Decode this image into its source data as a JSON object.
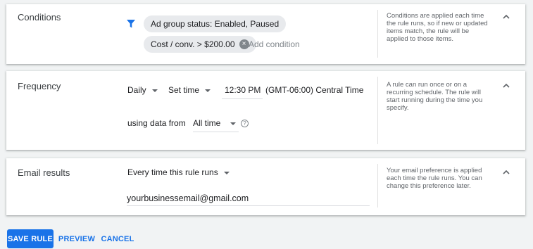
{
  "colors": {
    "accent": "#1a73e8",
    "background": "#f1f3f4",
    "chip": "#e8eaed"
  },
  "conditions": {
    "title": "Conditions",
    "filter_icon": "filter-icon",
    "chips": [
      {
        "label": "Ad group status: Enabled, Paused"
      },
      {
        "label": "Cost / conv. > $200.00"
      }
    ],
    "add_condition": "Add condition",
    "help": "Conditions are applied each time the rule runs, so if new or updated items match, the rule will be applied to those items.",
    "collapse_icon": "chevron-up-icon"
  },
  "frequency": {
    "title": "Frequency",
    "period": "Daily",
    "time_mode": "Set time",
    "time": "12:30 PM",
    "timezone": "(GMT-06:00) Central Time",
    "using_label": "using data from",
    "data_range": "All time",
    "help_icon": "question-circle-icon",
    "help": "A rule can run once or on a recurring schedule. The rule will start running during the time you specify.",
    "collapse_icon": "chevron-up-icon"
  },
  "email": {
    "title": "Email results",
    "option": "Every time this rule runs",
    "address": "yourbusinessemail@gmail.com",
    "help": "Your email preference is applied each time the rule runs. You can change this preference later.",
    "collapse_icon": "chevron-up-icon"
  },
  "actions": {
    "save": "SAVE RULE",
    "preview": "PREVIEW",
    "cancel": "CANCEL"
  }
}
